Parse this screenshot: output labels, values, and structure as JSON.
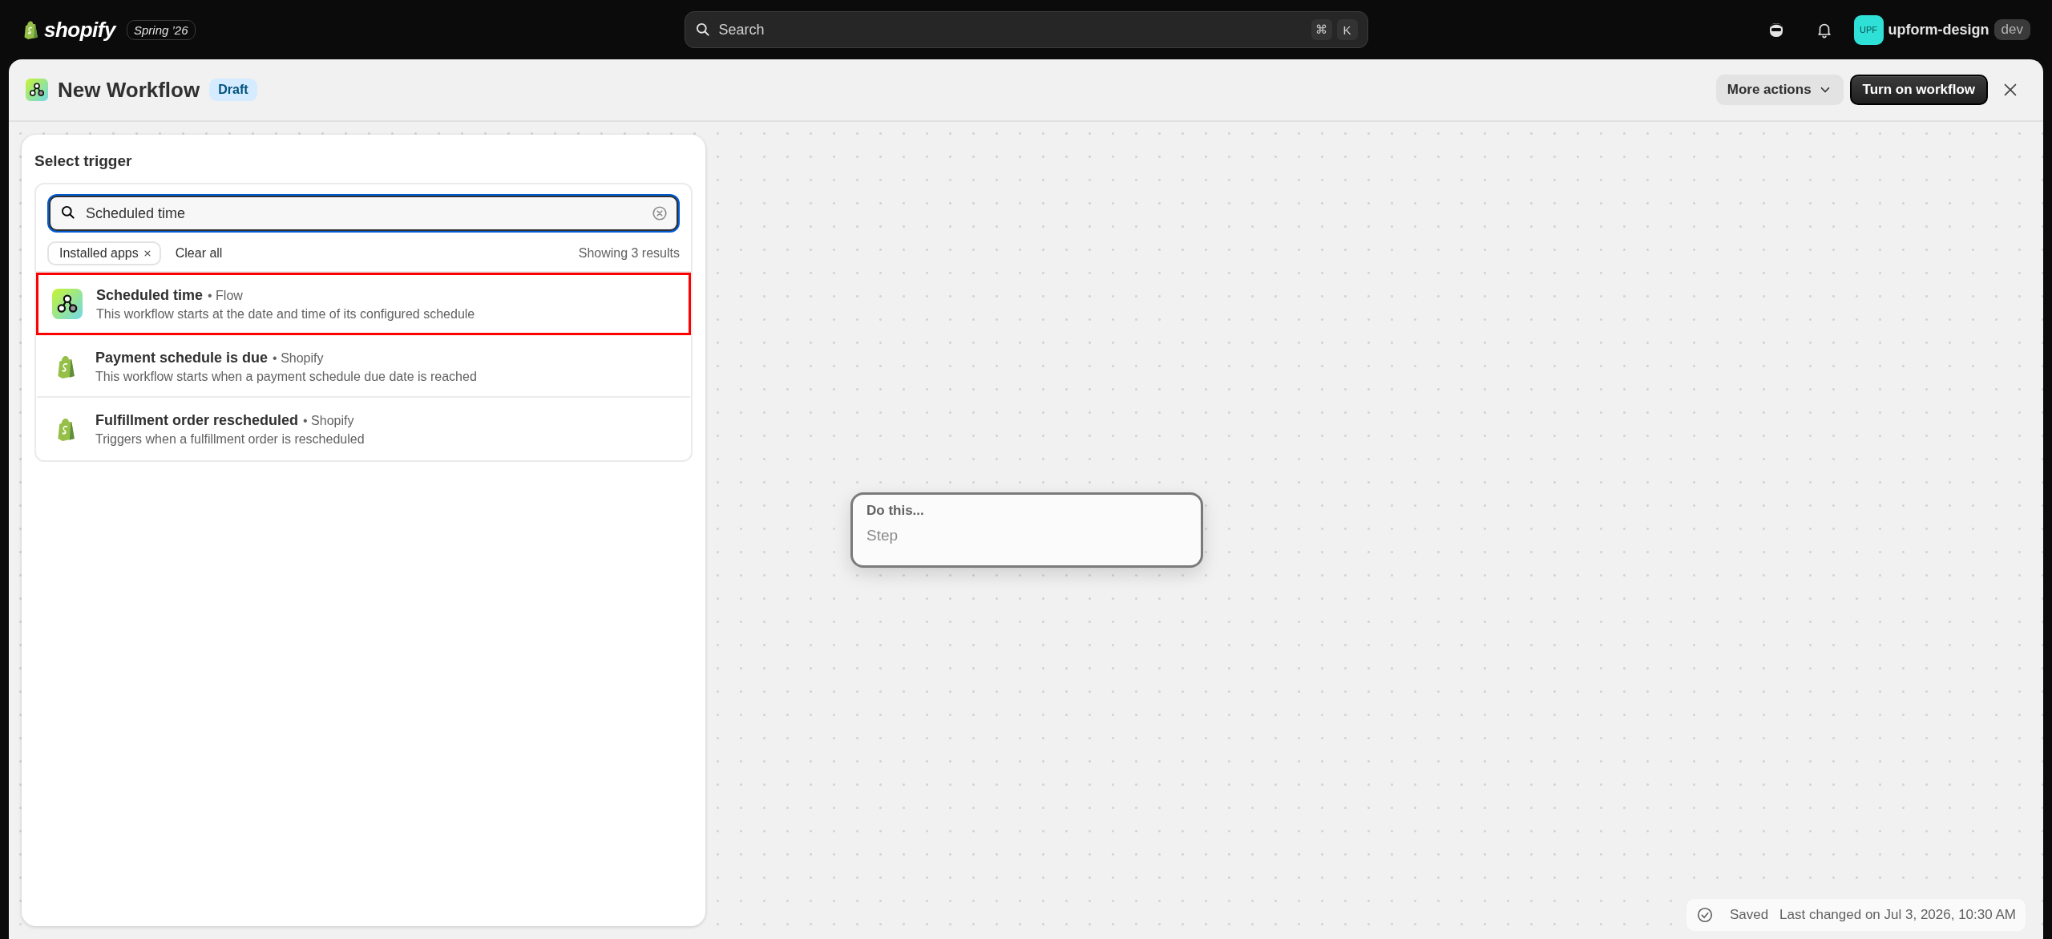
{
  "top_bar": {
    "logo_text": "shopify",
    "edition_badge": "Spring ’26",
    "search": {
      "placeholder": "Search",
      "shortcut_keys": [
        "⌘",
        "K"
      ]
    },
    "account": {
      "avatar_initials": "UPF",
      "store_name": "upform-design",
      "badge": "dev"
    }
  },
  "header": {
    "title": "New Workflow",
    "status_badge": "Draft",
    "buttons": [
      {
        "label": "More actions",
        "kind": "menu"
      },
      {
        "label": "Turn on workflow",
        "kind": "primary"
      }
    ]
  },
  "trigger_panel": {
    "title": "Select trigger",
    "search": {
      "value": "Scheduled time"
    },
    "filters": [
      {
        "label": "Installed apps"
      }
    ],
    "clear_label": "Clear all",
    "result_count": "Showing 3 results",
    "results": [
      {
        "title": "Scheduled time",
        "source": "• Flow",
        "description": "This workflow starts at the date and time of its configured schedule",
        "kind": "flow",
        "selected": true
      },
      {
        "title": "Payment schedule is due",
        "source": "• Shopify",
        "description": "This workflow starts when a payment schedule due date is reached",
        "kind": "shopify",
        "selected": false
      },
      {
        "title": "Fulfillment order rescheduled",
        "source": "• Shopify",
        "description": "Triggers when a fulfillment order is rescheduled",
        "kind": "shopify",
        "selected": false
      }
    ]
  },
  "canvas": {
    "node": {
      "title": "Do this...",
      "step": "Step"
    }
  },
  "save_status": {
    "label": "Saved",
    "detail": "Last changed on Jul 3, 2026, 10:30 AM"
  }
}
